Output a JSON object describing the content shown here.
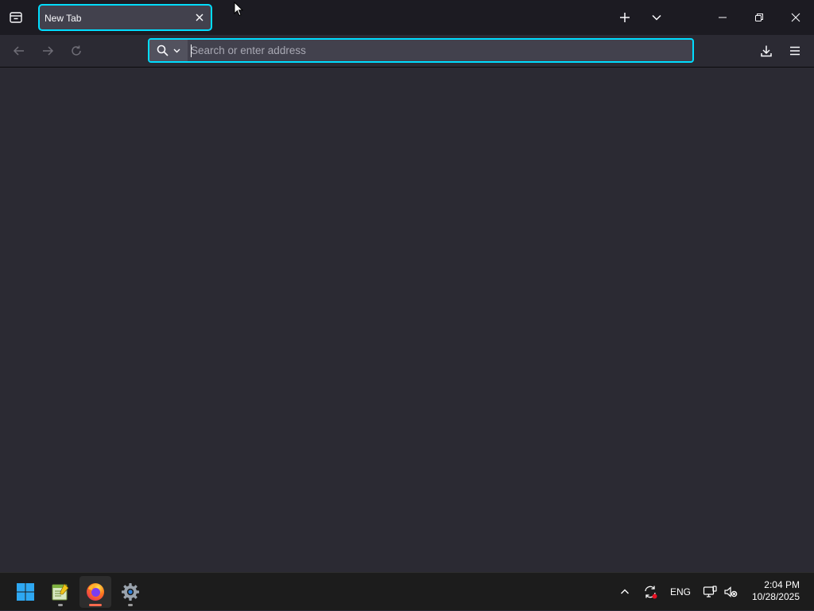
{
  "browser": {
    "tab": {
      "title": "New Tab"
    },
    "urlbar": {
      "placeholder": "Search or enter address",
      "value": ""
    },
    "icons": {
      "tab_overview": "firefox-view-icon",
      "tab_close": "close-icon",
      "new_tab": "plus-icon",
      "list_tabs": "chevron-down-icon",
      "minimize": "minimize-icon",
      "restore": "restore-icon",
      "close_window": "close-icon",
      "back": "arrow-left-icon",
      "forward": "arrow-right-icon",
      "reload": "reload-icon",
      "search": "search-icon",
      "downloads": "download-icon",
      "menu": "hamburger-menu-icon"
    },
    "colors": {
      "accent": "#00ddff",
      "toolbar": "#2b2a33",
      "tabstrip": "#1c1b22",
      "tab_selected": "#42414d"
    }
  },
  "taskbar": {
    "apps": [
      {
        "name": "start",
        "icon": "windows-start-icon"
      },
      {
        "name": "notepad-plus-plus",
        "icon": "notepad-plus-plus-icon"
      },
      {
        "name": "firefox",
        "icon": "firefox-icon",
        "active": true
      },
      {
        "name": "settings",
        "icon": "settings-gear-icon"
      }
    ],
    "tray": {
      "language": "ENG",
      "icons": [
        "chevron-up-icon",
        "sync-update-icon",
        "network-icon",
        "volume-muted-icon"
      ]
    },
    "clock": {
      "time": "2:04 PM",
      "date": "10/28/2025"
    }
  }
}
